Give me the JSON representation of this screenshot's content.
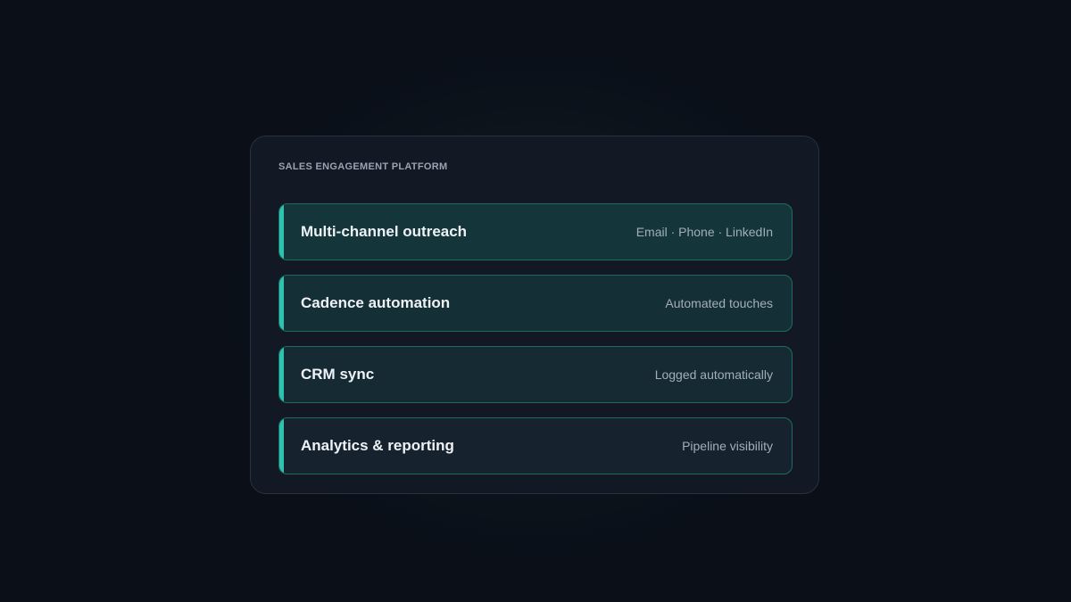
{
  "panel": {
    "eyebrow": "SALES ENGAGEMENT PLATFORM",
    "rows": [
      {
        "title": "Multi-channel outreach",
        "subtitle": "Email · Phone · LinkedIn"
      },
      {
        "title": "Cadence automation",
        "subtitle": "Automated touches"
      },
      {
        "title": "CRM sync",
        "subtitle": "Logged automatically"
      },
      {
        "title": "Analytics & reporting",
        "subtitle": "Pipeline visibility"
      }
    ]
  },
  "colors": {
    "background": "#0a0f18",
    "card": "#121925",
    "accent": "#2cc3b0",
    "row_border": "#1f6b64"
  }
}
